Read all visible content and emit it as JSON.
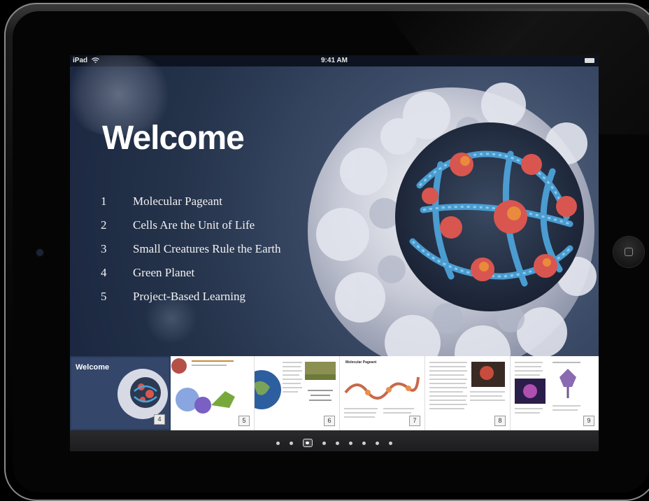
{
  "status_bar": {
    "device": "iPad",
    "time": "9:41 AM"
  },
  "content": {
    "title": "Welcome",
    "toc": [
      {
        "num": "1",
        "label": "Molecular Pageant"
      },
      {
        "num": "2",
        "label": "Cells Are the Unit of Life"
      },
      {
        "num": "3",
        "label": "Small Creatures Rule the Earth"
      },
      {
        "num": "4",
        "label": "Green Planet"
      },
      {
        "num": "5",
        "label": "Project-Based Learning"
      }
    ]
  },
  "thumbnails": [
    {
      "title": "Welcome",
      "page": "4",
      "selected": true
    },
    {
      "title": "",
      "page": "5",
      "selected": false
    },
    {
      "title": "",
      "page": "6",
      "selected": false
    },
    {
      "title": "Molecular Pageant",
      "page": "7",
      "selected": false
    },
    {
      "title": "",
      "page": "8",
      "selected": false
    },
    {
      "title": "",
      "page": "9",
      "selected": false
    }
  ],
  "pager": {
    "count": 9,
    "current_index": 2
  },
  "icons": {
    "wifi": "wifi-icon",
    "battery": "battery-icon",
    "home": "home-button-icon"
  },
  "colors": {
    "screen_bg": "#2c3a52",
    "accent_red": "#d8564f",
    "accent_blue": "#4da2d8"
  }
}
